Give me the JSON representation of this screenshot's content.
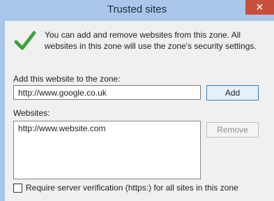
{
  "window": {
    "title": "Trusted sites",
    "close_glyph": "✕"
  },
  "info": {
    "icon": "check-icon",
    "text": "You can add and remove websites from this zone. All websites in this zone will use the zone's security settings."
  },
  "add_section": {
    "label": "Add this website to the zone:",
    "input_value": "http://www.google.co.uk",
    "add_button": "Add"
  },
  "websites": {
    "label": "Websites:",
    "items": [
      "http://www.website.com"
    ],
    "remove_button": "Remove"
  },
  "require_verification": {
    "label": "Require server verification (https:) for all sites in this zone",
    "checked": false
  },
  "colors": {
    "title_bar": "#aac6ea",
    "close_button": "#c7503d",
    "check_mark": "#3da33b"
  }
}
